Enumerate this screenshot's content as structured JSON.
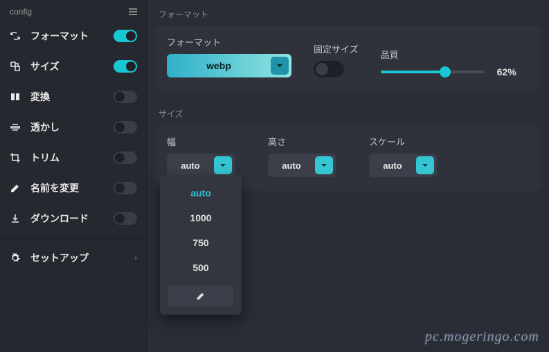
{
  "sidebar": {
    "header": "config",
    "items": [
      {
        "label": "フォーマット",
        "icon": "refresh-icon",
        "on": true
      },
      {
        "label": "サイズ",
        "icon": "resize-icon",
        "on": true
      },
      {
        "label": "変換",
        "icon": "split-icon",
        "on": false
      },
      {
        "label": "透かし",
        "icon": "overlay-icon",
        "on": false
      },
      {
        "label": "トリム",
        "icon": "crop-icon",
        "on": false
      },
      {
        "label": "名前を変更",
        "icon": "rename-icon",
        "on": false
      },
      {
        "label": "ダウンロード",
        "icon": "download-icon",
        "on": false
      }
    ],
    "setup": "セットアップ"
  },
  "format": {
    "section": "フォーマット",
    "format_label": "フォーマット",
    "format_value": "webp",
    "fixed_label": "固定サイズ",
    "fixed_on": false,
    "quality_label": "品質",
    "quality_pct": "62%",
    "quality_value": 62
  },
  "size": {
    "section": "サイズ",
    "width_label": "幅",
    "width_value": "auto",
    "height_label": "高さ",
    "height_value": "auto",
    "scale_label": "スケール",
    "scale_value": "auto",
    "dropdown": [
      "auto",
      "1000",
      "750",
      "500"
    ]
  },
  "watermark_text": "pc.mogeringo.com"
}
